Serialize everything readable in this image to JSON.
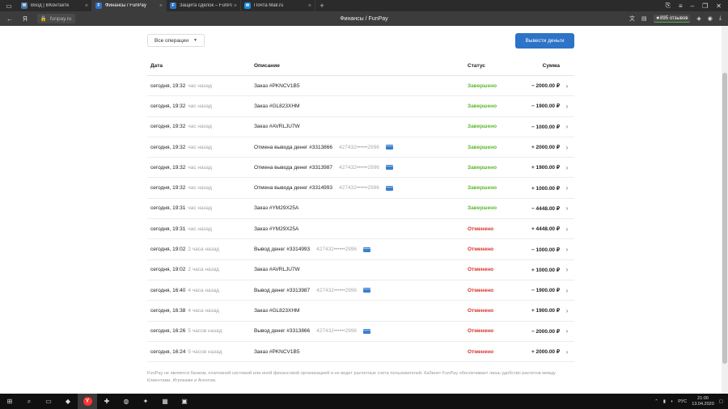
{
  "browser": {
    "tabs": [
      {
        "label": "Вход | ВКонтакте",
        "favicon": "vk-icon",
        "fav_color": "#4a76a8",
        "fav_char": "W",
        "active": false
      },
      {
        "label": "Финансы / FunPay",
        "favicon": "funpay-icon",
        "fav_color": "#2d73c7",
        "fav_char": "F",
        "active": true
      },
      {
        "label": "Защита сделок – FunPay!!",
        "favicon": "funpay-icon",
        "fav_color": "#2d73c7",
        "fav_char": "F",
        "active": false
      },
      {
        "label": "Почта Mail.ru",
        "favicon": "mail-icon",
        "fav_color": "#168de2",
        "fav_char": "✉",
        "active": false
      }
    ],
    "url": "funpay.ru",
    "page_title": "Финансы / FunPay",
    "reviews_badge": "★895 отзывов"
  },
  "toolbar": {
    "filter_label": "Все операции",
    "withdraw_label": "Вывести деньги"
  },
  "table": {
    "headers": {
      "date": "Дата",
      "description": "Описание",
      "status": "Статус",
      "sum": "Сумма"
    },
    "rows": [
      {
        "date": "сегодня, 19:32",
        "ago": "час назад",
        "desc": "Заказ #PKNCV1B5",
        "card": "",
        "status": "Завершено",
        "status_type": "done",
        "sum": "− 2000.00 ₽"
      },
      {
        "date": "сегодня, 19:32",
        "ago": "час назад",
        "desc": "Заказ #GL823XHM",
        "card": "",
        "status": "Завершено",
        "status_type": "done",
        "sum": "− 1900.00 ₽"
      },
      {
        "date": "сегодня, 19:32",
        "ago": "час назад",
        "desc": "Заказ #AVRLJU7W",
        "card": "",
        "status": "Завершено",
        "status_type": "done",
        "sum": "− 1000.00 ₽"
      },
      {
        "date": "сегодня, 19:32",
        "ago": "час назад",
        "desc": "Отмена вывода денег #3313866",
        "card": "427432••••••2996",
        "status": "Завершено",
        "status_type": "done",
        "sum": "+ 2000.00 ₽"
      },
      {
        "date": "сегодня, 19:32",
        "ago": "час назад",
        "desc": "Отмена вывода денег #3313987",
        "card": "427432••••••2996",
        "status": "Завершено",
        "status_type": "done",
        "sum": "+ 1900.00 ₽"
      },
      {
        "date": "сегодня, 19:32",
        "ago": "час назад",
        "desc": "Отмена вывода денег #3314993",
        "card": "427432••••••2996",
        "status": "Завершено",
        "status_type": "done",
        "sum": "+ 1000.00 ₽"
      },
      {
        "date": "сегодня, 19:31",
        "ago": "час назад",
        "desc": "Заказ #YM29X25A",
        "card": "",
        "status": "Завершено",
        "status_type": "done",
        "sum": "− 4448.00 ₽"
      },
      {
        "date": "сегодня, 19:31",
        "ago": "час назад",
        "desc": "Заказ #YM29X25A",
        "card": "",
        "status": "Отменено",
        "status_type": "cancel",
        "sum": "+ 4448.00 ₽"
      },
      {
        "date": "сегодня, 19:02",
        "ago": "2 часа назад",
        "desc": "Вывод денег #3314993",
        "card": "427432••••••2996",
        "status": "Отменено",
        "status_type": "cancel",
        "sum": "− 1000.00 ₽"
      },
      {
        "date": "сегодня, 19:02",
        "ago": "2 часа назад",
        "desc": "Заказ #AVRLJU7W",
        "card": "",
        "status": "Отменено",
        "status_type": "cancel",
        "sum": "+ 1000.00 ₽"
      },
      {
        "date": "сегодня, 16:40",
        "ago": "4 часа назад",
        "desc": "Вывод денег #3313987",
        "card": "427432••••••2996",
        "status": "Отменено",
        "status_type": "cancel",
        "sum": "− 1900.00 ₽"
      },
      {
        "date": "сегодня, 16:38",
        "ago": "4 часа назад",
        "desc": "Заказ #GL823XHM",
        "card": "",
        "status": "Отменено",
        "status_type": "cancel",
        "sum": "+ 1900.00 ₽"
      },
      {
        "date": "сегодня, 16:26",
        "ago": "5 часов назад",
        "desc": "Вывод денег #3313866",
        "card": "427432••••••2996",
        "status": "Отменено",
        "status_type": "cancel",
        "sum": "− 2000.00 ₽"
      },
      {
        "date": "сегодня, 16:24",
        "ago": "5 часов назад",
        "desc": "Заказ #PKNCV1B5",
        "card": "",
        "status": "Отменено",
        "status_type": "cancel",
        "sum": "+ 2000.00 ₽"
      }
    ]
  },
  "footnote": "FunPay не является банком, платежной системой или иной финансовой организацией и не ведет расчетные счета пользователей. Кабинет FunPay обеспечивает лишь удобство расчетов между Клиентами, Игроками и Агентом.",
  "taskbar": {
    "language": "РУС",
    "time": "21:00",
    "date": "13.04.2020"
  },
  "colors": {
    "accent": "#2d73c7",
    "done": "#5cb82e",
    "cancel": "#d9302b"
  }
}
